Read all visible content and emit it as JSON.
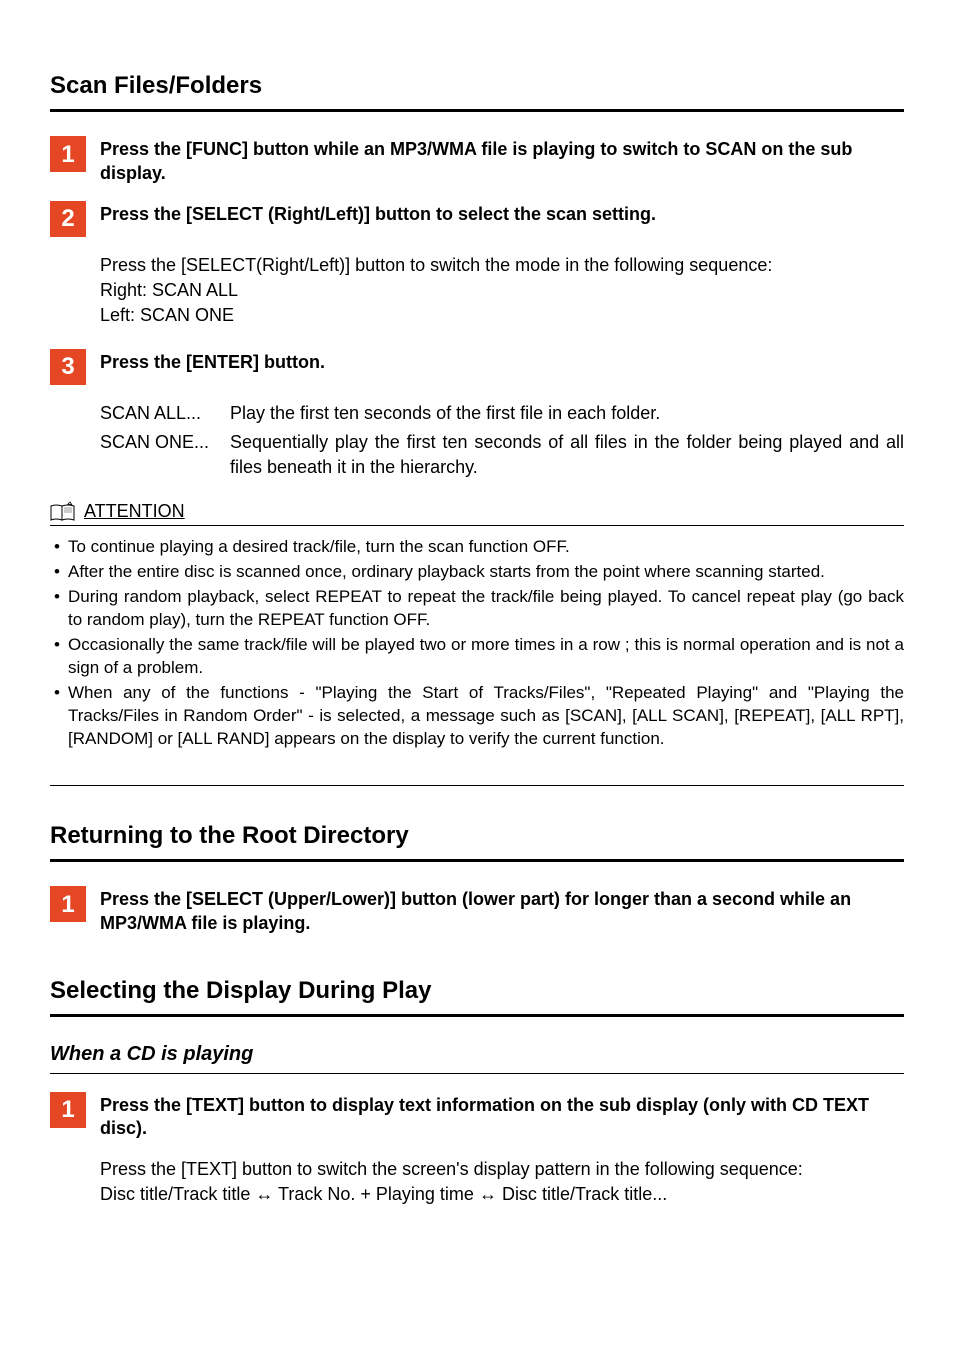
{
  "section1": {
    "title": "Scan Files/Folders",
    "steps": [
      {
        "n": "1",
        "text": "Press the [FUNC] button while an MP3/WMA file is playing to switch to SCAN on the sub display."
      },
      {
        "n": "2",
        "text": "Press the [SELECT (Right/Left)] button to select the scan setting."
      },
      {
        "n": "3",
        "text": "Press the [ENTER] button."
      }
    ],
    "body2": {
      "intro": "Press the [SELECT(Right/Left)] button to switch the mode in the following sequence:",
      "right": "Right: SCAN ALL",
      "left": "Left: SCAN ONE"
    },
    "body3": {
      "all_label": "SCAN ALL...",
      "all_text": "Play the first ten seconds of the first file in each folder.",
      "one_label": "SCAN ONE...",
      "one_text": "Sequentially play the first ten seconds of all files in the folder being played and all files beneath it in the hierarchy."
    },
    "attention": {
      "label": "ATTENTION",
      "items": [
        "To continue playing a desired track/file, turn the scan function OFF.",
        "After the entire disc is scanned once, ordinary playback starts from the point where scanning started.",
        "During random playback, select REPEAT to repeat the track/file being played.  To cancel repeat play (go back to random play), turn the REPEAT function OFF.",
        "Occasionally the same track/file will be played two or more times in a row ; this is normal operation and is not a sign of a problem.",
        "When any of the functions - \"Playing the Start of Tracks/Files\", \"Repeated Playing\" and \"Playing the Tracks/Files in Random Order\" - is selected, a message such as [SCAN], [ALL SCAN], [REPEAT], [ALL RPT], [RANDOM] or [ALL RAND] appears on the display to verify the current function."
      ]
    }
  },
  "section2": {
    "title": "Returning to the Root Directory",
    "step": {
      "n": "1",
      "text": "Press the [SELECT (Upper/Lower)] button (lower part) for longer than a second while an MP3/WMA file is playing."
    }
  },
  "section3": {
    "title": "Selecting the Display During Play",
    "sub": "When a CD is playing",
    "step": {
      "n": "1",
      "text": "Press the [TEXT] button to display text information on the sub display (only with CD TEXT disc)."
    },
    "body": {
      "intro": "Press the [TEXT] button to switch the screen's display pattern in the following sequence:",
      "seq_a": "Disc title/Track title ",
      "seq_b": " Track No. + Playing time ",
      "seq_c": " Disc title/Track title..."
    }
  }
}
